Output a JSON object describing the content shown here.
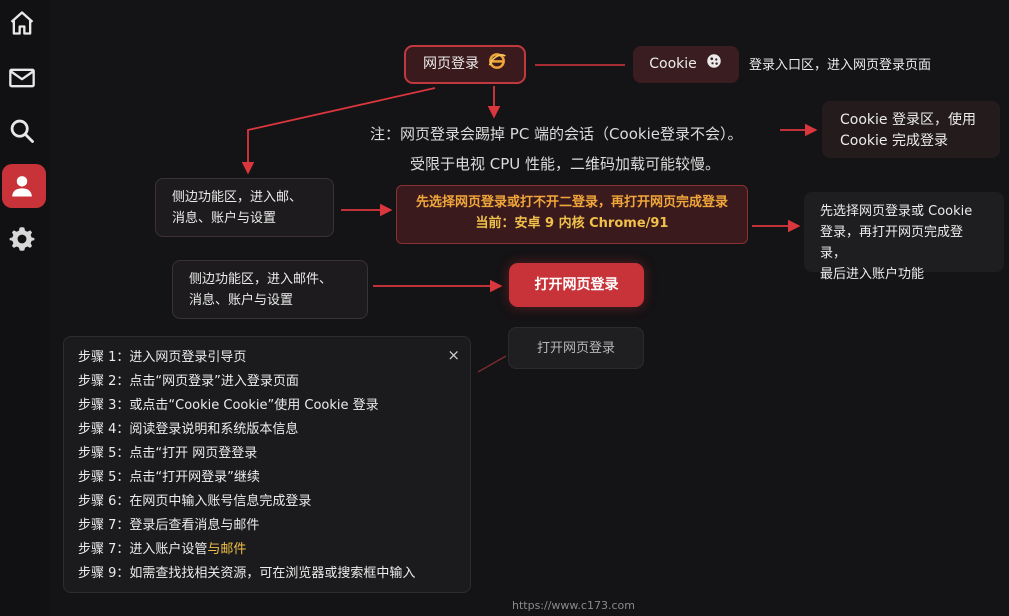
{
  "sidebar": {
    "items": [
      {
        "icon": "home-icon"
      },
      {
        "icon": "mail-icon"
      },
      {
        "icon": "search-icon"
      },
      {
        "icon": "user-icon",
        "active": true
      },
      {
        "icon": "gear-icon"
      }
    ]
  },
  "nodes": {
    "web_login": "网页登录",
    "cookie": "Cookie",
    "entry_label": "登录入口区，进入网页登录页面",
    "note_line1": "注：网页登录会踢掉 PC 端的会话（Cookie登录不会）。",
    "note_line2": "受限于电视 CPU 性能，二维码加载可能较慢。",
    "cookie_area_line1": "Cookie 登录区，使用",
    "cookie_area_line2": "Cookie 完成登录",
    "side1_line1": "侧边功能区，进入邮、",
    "side1_line2": "消息、账户与设置",
    "center_line1": "先选择网页登录或打不开二登录，再打开网页完成登录",
    "center_line2": "当前：安卓 9  内核 Chrome/91",
    "right2_line1": "先选择网页登录或 Cookie",
    "right2_line2": "登录，再打开网页完成登录，",
    "right2_line3": "最后进入账户功能",
    "side2_line1": "侧边功能区，进入邮件、",
    "side2_line2": "消息、账户与设置",
    "open_web": "打开网页登录",
    "open_web_ghost": "打开网页登录"
  },
  "steps": {
    "close": "×",
    "items": [
      "步骤 1：进入网页登录引导页",
      "步骤 2：点击“网页登录”进入登录页面",
      "步骤 3：或点击“Cookie Cookie”使用 Cookie 登录",
      "步骤 4：阅读登录说明和系统版本信息",
      "步骤 5：点击“打开 网页登登录",
      "步骤 5：点击“打开网登录”继续",
      "步骤 6：在网页中输入账号信息完成登录",
      "步骤 7：登录后查看消息与邮件",
      "步骤 7：进入账户设管",
      "步骤 9：如需查找找相关资源，可在浏览器或搜索框中输入"
    ],
    "item9_highlight": "与邮件"
  },
  "footer": {
    "url": "https://www.c173.com"
  },
  "colors": {
    "accent": "#c8333a",
    "highlight": "#f1c04a",
    "background": "#141315"
  }
}
